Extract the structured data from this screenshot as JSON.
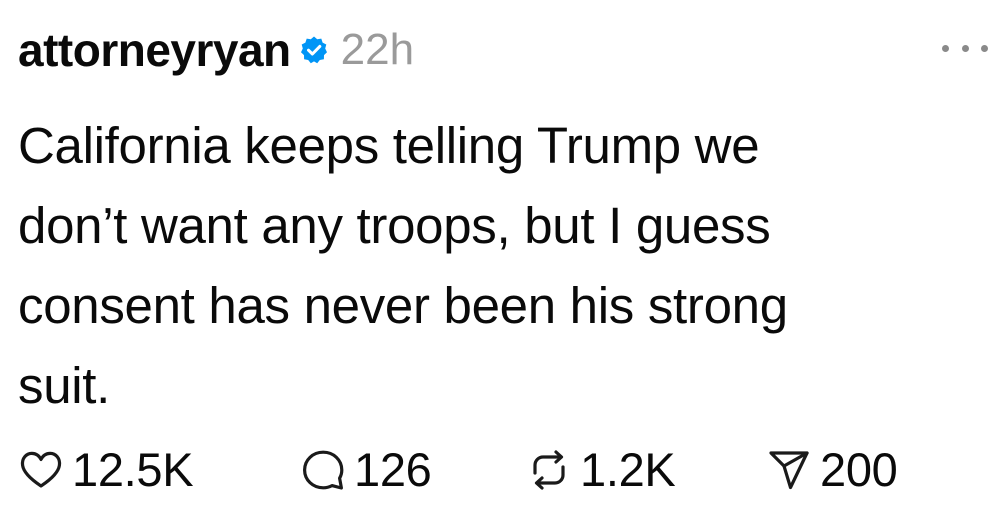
{
  "post": {
    "username": "attorneyryan",
    "verified": true,
    "timestamp": "22h",
    "more_icon": "more-horizontal-icon",
    "text_lines": [
      "California keeps telling Trump we",
      "don’t want any troops, but I guess",
      "consent has never been his strong",
      "suit."
    ],
    "actions": {
      "likes": {
        "icon": "heart-icon",
        "count": "12.5K"
      },
      "replies": {
        "icon": "comment-icon",
        "count": "126"
      },
      "reposts": {
        "icon": "repost-icon",
        "count": "1.2K"
      },
      "shares": {
        "icon": "send-icon",
        "count": "200"
      }
    }
  },
  "colors": {
    "text": "#0a0a0a",
    "timestamp": "#9a9a9a",
    "verified_badge": "#0095f6",
    "icon_stroke": "#1a1a1a"
  }
}
